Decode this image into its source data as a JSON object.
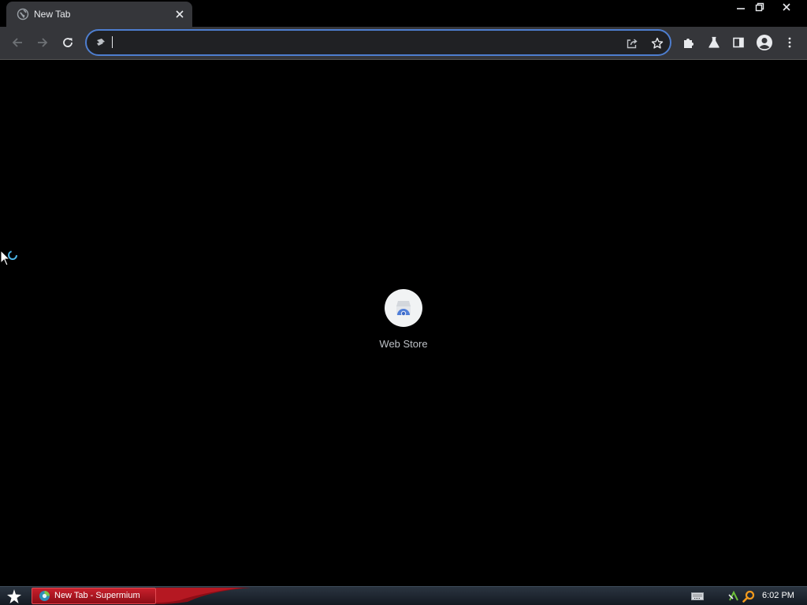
{
  "browser": {
    "tab": {
      "title": "New Tab",
      "close_icon": "close-icon",
      "favicon": "globe-icon"
    },
    "window_controls": {
      "minimize_icon": "minimize-icon",
      "restore_icon": "restore-icon",
      "close_icon": "close-icon"
    },
    "toolbar": {
      "back_icon": "back-arrow-icon",
      "forward_icon": "forward-arrow-icon",
      "reload_icon": "reload-icon",
      "address_value": "",
      "address_icon": "site-info-icon",
      "share_icon": "share-icon",
      "bookmark_icon": "star-icon",
      "extensions_icon": "puzzle-icon",
      "labs_icon": "flask-icon",
      "side_panel_icon": "side-panel-icon",
      "profile_icon": "profile-icon",
      "menu_icon": "kebab-menu-icon"
    },
    "accent_color": "#4e7ecf"
  },
  "new_tab_page": {
    "shortcuts": [
      {
        "label": "Web Store",
        "icon": "web-store-icon"
      }
    ]
  },
  "taskbar": {
    "start_icon": "star-start-icon",
    "items": [
      {
        "label": "New Tab - Supermium",
        "icon": "supermium-icon",
        "color": "#c8202c"
      }
    ],
    "tray": {
      "keyboard_icon": "keyboard-icon",
      "network_icon": "network-icon",
      "search_icon": "magnifier-icon"
    },
    "clock": "6:02 PM"
  }
}
